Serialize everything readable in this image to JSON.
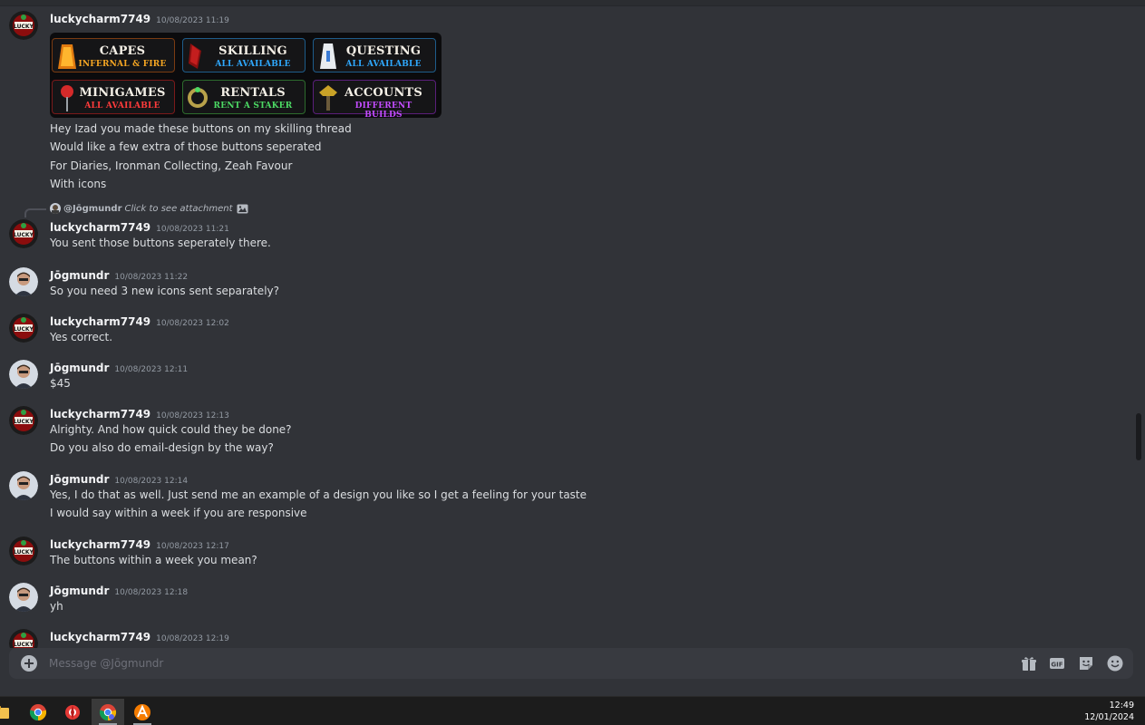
{
  "chat": {
    "messages": [
      {
        "id": "m1",
        "author": "luckycharm7749",
        "timestamp": "10/08/2023 11:19",
        "avatar": "lucky-avatar",
        "attachment_buttons": [
          {
            "title": "CAPES",
            "subtitle": "INFERNAL & FIRE",
            "subtitle_color": "#f5a623",
            "icon": "cape-icon"
          },
          {
            "title": "SKILLING",
            "subtitle": "ALL AVAILABLE",
            "subtitle_color": "#2fa9ff",
            "icon": "skilling-cape-icon"
          },
          {
            "title": "QUESTING",
            "subtitle": "ALL AVAILABLE",
            "subtitle_color": "#2fa9ff",
            "icon": "quest-cape-icon"
          },
          {
            "title": "MINIGAMES",
            "subtitle": "ALL AVAILABLE",
            "subtitle_color": "#ff3b3b",
            "icon": "minigame-icon"
          },
          {
            "title": "RENTALS",
            "subtitle": "RENT A STAKER",
            "subtitle_color": "#4cd964",
            "icon": "rental-ring-icon"
          },
          {
            "title": "ACCOUNTS",
            "subtitle": "DIFFERENT BUILDS",
            "subtitle_color": "#c34cff",
            "icon": "accounts-icon"
          }
        ],
        "lines": [
          "Hey Izad you made these buttons on my skilling thread",
          "Would like a few extra of those buttons seperated",
          "For Diaries, Ironman Collecting, Zeah Favour",
          "With icons"
        ]
      },
      {
        "id": "m2",
        "reply": {
          "name": "@Jōgmundr",
          "text": "Click to see attachment"
        },
        "author": "luckycharm7749",
        "timestamp": "10/08/2023 11:21",
        "lines": [
          "You sent those buttons seperately there."
        ]
      },
      {
        "id": "m3",
        "author": "Jōgmundr",
        "timestamp": "10/08/2023 11:22",
        "lines": [
          "So you need 3 new icons sent separately?"
        ]
      },
      {
        "id": "m4",
        "author": "luckycharm7749",
        "timestamp": "10/08/2023 12:02",
        "lines": [
          "Yes correct."
        ]
      },
      {
        "id": "m5",
        "author": "Jōgmundr",
        "timestamp": "10/08/2023 12:11",
        "lines": [
          "$45"
        ]
      },
      {
        "id": "m6",
        "author": "luckycharm7749",
        "timestamp": "10/08/2023 12:13",
        "lines": [
          "Alrighty. And how quick could they be done?",
          "Do you also do email-design by the way?"
        ]
      },
      {
        "id": "m7",
        "author": "Jōgmundr",
        "timestamp": "10/08/2023 12:14",
        "lines": [
          "Yes, I do that as well. Just send me an example of a design you like so I get a feeling for your taste",
          "I would say within a week if you are responsive"
        ]
      },
      {
        "id": "m8",
        "author": "luckycharm7749",
        "timestamp": "10/08/2023 12:17",
        "lines": [
          "The buttons within a week you mean?"
        ]
      },
      {
        "id": "m9",
        "author": "Jōgmundr",
        "timestamp": "10/08/2023 12:18",
        "lines": [
          "yh"
        ]
      },
      {
        "id": "m10",
        "author": "luckycharm7749",
        "timestamp": "10/08/2023 12:19",
        "lines": []
      }
    ]
  },
  "composer": {
    "placeholder": "Message @Jōgmundr",
    "tools": [
      "gift-icon",
      "gif-icon",
      "sticker-icon",
      "emoji-icon"
    ],
    "gif_label": "GIF"
  },
  "taskbar": {
    "apps": [
      "file-explorer-icon",
      "chrome-icon",
      "app-red-icon",
      "chrome-active-icon",
      "app-orange-icon"
    ],
    "time": "12:49",
    "date": "12/01/2024"
  },
  "colors": {
    "background": "#313338",
    "composer": "#383a40",
    "username": "#f2f3f5",
    "timestamp": "#949ba4"
  }
}
